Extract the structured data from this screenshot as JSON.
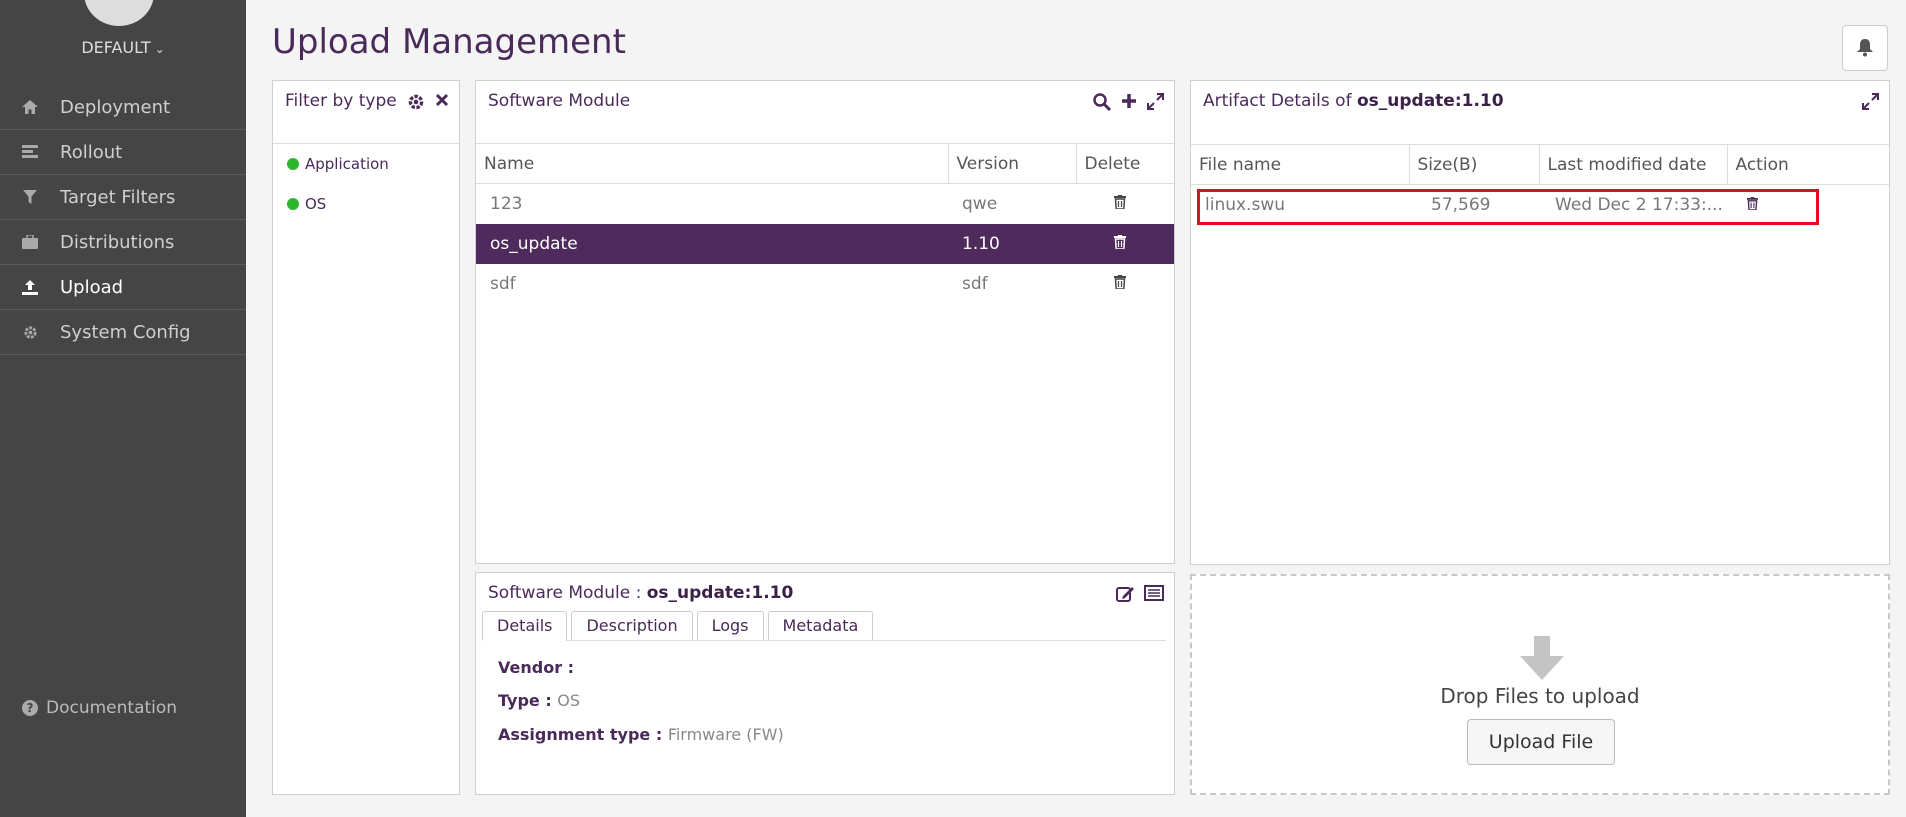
{
  "sidebar": {
    "tenant": "DEFAULT",
    "items": [
      {
        "label": "Deployment",
        "icon": "home-icon"
      },
      {
        "label": "Rollout",
        "icon": "rollout-icon"
      },
      {
        "label": "Target Filters",
        "icon": "filter-icon"
      },
      {
        "label": "Distributions",
        "icon": "briefcase-icon"
      },
      {
        "label": "Upload",
        "icon": "upload-icon",
        "active": true
      },
      {
        "label": "System Config",
        "icon": "gear-icon"
      }
    ],
    "documentation": "Documentation"
  },
  "header": {
    "title": "Upload Management"
  },
  "filter": {
    "title": "Filter by type",
    "types": [
      "Application",
      "OS"
    ]
  },
  "software_module": {
    "title": "Software Module",
    "columns": [
      "Name",
      "Version",
      "Delete"
    ],
    "rows": [
      {
        "name": "123",
        "version": "qwe"
      },
      {
        "name": "os_update",
        "version": "1.10"
      },
      {
        "name": "sdf",
        "version": "sdf"
      }
    ],
    "selected_index": 1
  },
  "details": {
    "title_prefix": "Software Module : ",
    "title_value": "os_update:1.10",
    "tabs": [
      "Details",
      "Description",
      "Logs",
      "Metadata"
    ],
    "vendor_label": "Vendor : ",
    "vendor_value": "",
    "type_label": "Type : ",
    "type_value": "OS",
    "assignment_label": "Assignment type : ",
    "assignment_value": "Firmware (FW)"
  },
  "artifacts": {
    "title_prefix": "Artifact Details of ",
    "title_value": "os_update:1.10",
    "columns": [
      "File name",
      "Size(B)",
      "Last modified date",
      "Action"
    ],
    "rows": [
      {
        "file": "linux.swu",
        "size": "57,569",
        "modified": "Wed Dec 2 17:33:..."
      }
    ]
  },
  "drop": {
    "text": "Drop Files to upload",
    "button": "Upload File"
  },
  "colors": {
    "brand": "#4f2a5c",
    "accent_green": "#2db52d",
    "highlight": "#e01020"
  }
}
